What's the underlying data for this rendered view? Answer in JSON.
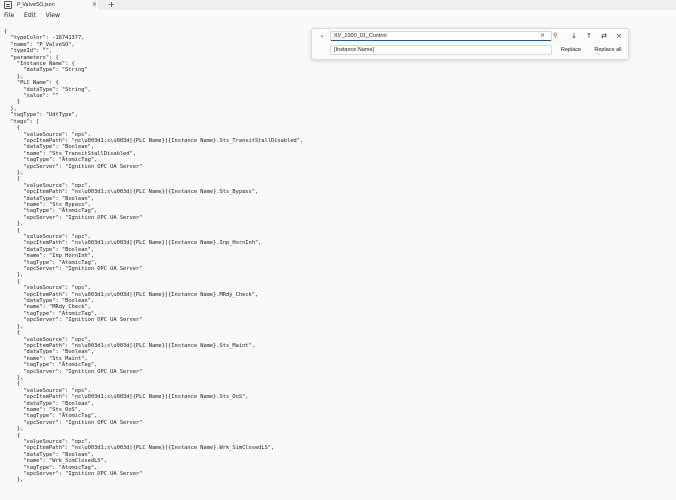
{
  "window": {
    "tab_title": "P_ValveSO.json",
    "tab_close": "×",
    "new_tab": "+"
  },
  "menu": {
    "items": [
      "File",
      "Edit",
      "View"
    ]
  },
  "find_replace": {
    "toggle_icon": "⌄",
    "find_value": "XV_1000_01_Control",
    "replace_value": "[Instance Name]",
    "clear_icon": "×",
    "search_icon": "⚲",
    "next_icon": "↓",
    "prev_icon": "↑",
    "options_icon": "⇄",
    "close_icon": "×",
    "replace_label": "Replace",
    "replace_all_label": "Replace all"
  },
  "editor": {
    "lines": [
      "{",
      "  \"typeColor\": -16741377,",
      "  \"name\": \"P_ValveSO\",",
      "  \"typeId\": \"\",",
      "  \"parameters\": {",
      "    \"Instance Name\": {",
      "      \"dataType\": \"String\"",
      "    },",
      "    \"PLC Name\": {",
      "      \"dataType\": \"String\",",
      "      \"value\": \"\"",
      "    }",
      "  },",
      "  \"tagType\": \"UdtType\",",
      "  \"tags\": [",
      "    {",
      "      \"valueSource\": \"opc\",",
      "      \"opcItemPath\": \"ns\\u003d1;s\\u003d[{PLC Name}]{Instance Name}.Sts_TransitStallDisabled\",",
      "      \"dataType\": \"Boolean\",",
      "      \"name\": \"Sts_TransitStallDisabled\",",
      "      \"tagType\": \"AtomicTag\",",
      "      \"opcServer\": \"Ignition OPC UA Server\"",
      "    },",
      "    {",
      "      \"valueSource\": \"opc\",",
      "      \"opcItemPath\": \"ns\\u003d1;s\\u003d[{PLC Name}]{Instance Name}.Sts_Bypass\",",
      "      \"dataType\": \"Boolean\",",
      "      \"name\": \"Sts_Bypass\",",
      "      \"tagType\": \"AtomicTag\",",
      "      \"opcServer\": \"Ignition OPC UA Server\"",
      "    },",
      "    {",
      "      \"valueSource\": \"opc\",",
      "      \"opcItemPath\": \"ns\\u003d1;s\\u003d[{PLC Name}]{Instance Name}.Inp_HornInh\",",
      "      \"dataType\": \"Boolean\",",
      "      \"name\": \"Inp_HornInh\",",
      "      \"tagType\": \"AtomicTag\",",
      "      \"opcServer\": \"Ignition OPC UA Server\"",
      "    },",
      "    {",
      "      \"valueSource\": \"opc\",",
      "      \"opcItemPath\": \"ns\\u003d1;s\\u003d[{PLC Name}]{Instance Name}.MRdy_Check\",",
      "      \"dataType\": \"Boolean\",",
      "      \"name\": \"MRdy_Check\",",
      "      \"tagType\": \"AtomicTag\",",
      "      \"opcServer\": \"Ignition OPC UA Server\"",
      "    },",
      "    {",
      "      \"valueSource\": \"opc\",",
      "      \"opcItemPath\": \"ns\\u003d1;s\\u003d[{PLC Name}]{Instance Name}.Sts_Maint\",",
      "      \"dataType\": \"Boolean\",",
      "      \"name\": \"Sts_Maint\",",
      "      \"tagType\": \"AtomicTag\",",
      "      \"opcServer\": \"Ignition OPC UA Server\"",
      "    },",
      "    {",
      "      \"valueSource\": \"opc\",",
      "      \"opcItemPath\": \"ns\\u003d1;s\\u003d[{PLC Name}]{Instance Name}.Sts_OoS\",",
      "      \"dataType\": \"Boolean\",",
      "      \"name\": \"Sts_OoS\",",
      "      \"tagType\": \"AtomicTag\",",
      "      \"opcServer\": \"Ignition OPC UA Server\"",
      "    },",
      "    {",
      "      \"valueSource\": \"opc\",",
      "      \"opcItemPath\": \"ns\\u003d1;s\\u003d[{PLC Name}]{Instance Name}.Wrk_SimClosedLS\",",
      "      \"dataType\": \"Boolean\",",
      "      \"name\": \"Wrk_SimClosedLS\",",
      "      \"tagType\": \"AtomicTag\",",
      "      \"opcServer\": \"Ignition OPC UA Server\"",
      "    },"
    ]
  }
}
